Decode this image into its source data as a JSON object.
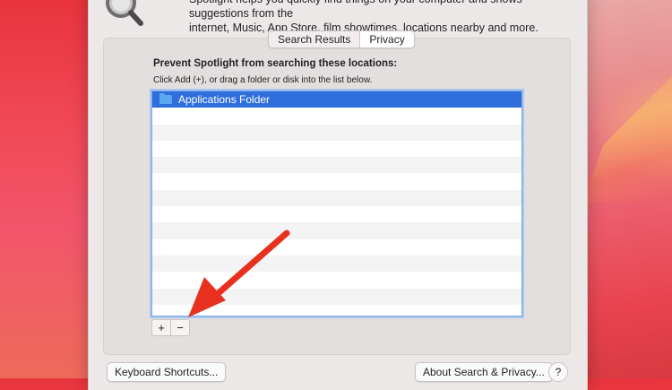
{
  "window": {
    "intro_line1": "Spotlight helps you quickly find things on your computer and shows suggestions from the",
    "intro_line2": "internet, Music, App Store, film showtimes, locations nearby and more."
  },
  "tabs": [
    {
      "label": "Search Results",
      "selected": false
    },
    {
      "label": "Privacy",
      "selected": true
    }
  ],
  "privacy": {
    "heading": "Prevent Spotlight from searching these locations:",
    "hint": "Click Add (+), or drag a folder or disk into the list below.",
    "items": [
      {
        "label": "Applications Folder",
        "icon": "folder-icon",
        "selected": true
      }
    ]
  },
  "list_controls": {
    "add": "+",
    "remove": "−"
  },
  "footer": {
    "keyboard_shortcuts": "Keyboard Shortcuts...",
    "about": "About Search & Privacy...",
    "help": "?"
  },
  "colors": {
    "accent": "#2f6fdb",
    "annotation_arrow": "#e8301f"
  }
}
